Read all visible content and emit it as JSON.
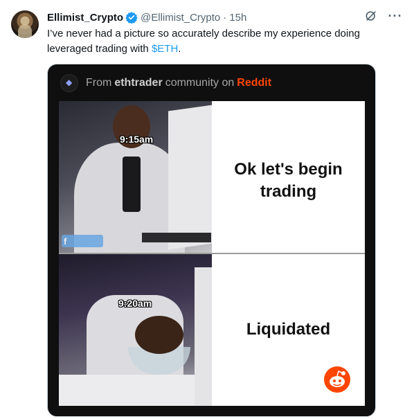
{
  "tweet": {
    "author_name": "Ellimist_Crypto",
    "handle": "@Ellimist_Crypto",
    "separator": "·",
    "time": "15h",
    "text_before": "I’ve never had a picture so accurately describe my experience doing leveraged trading with ",
    "cashtag": "$ETH",
    "text_after": "."
  },
  "icons": {
    "verified": "verified-badge-icon",
    "grok": "grok-icon",
    "more": "more-icon"
  },
  "media": {
    "source_prefix": "From",
    "community": "ethtrader",
    "source_middle": "community on",
    "platform": "Reddit",
    "panels": [
      {
        "time": "9:15am",
        "caption": "Ok let's begin trading"
      },
      {
        "time": "9:20am",
        "caption": "Liquidated"
      }
    ]
  },
  "colors": {
    "accent": "#1d9bf0",
    "reddit": "#ff4500",
    "text": "#0f1419",
    "secondary": "#536471"
  }
}
